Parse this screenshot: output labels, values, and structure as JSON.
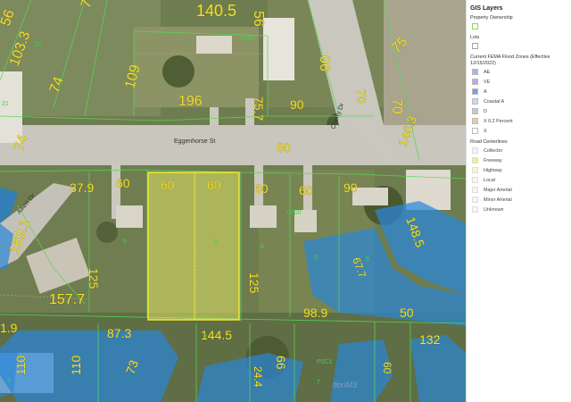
{
  "map": {
    "streets": [
      "Eggenhorse St",
      "Cherry Dr",
      "Aiken Dr"
    ],
    "dimensions": [
      "140.5",
      "56",
      "74",
      "56",
      "103.3",
      "74",
      "74",
      "109",
      "75.7",
      "196",
      "90",
      "90",
      "75",
      "70",
      "146.3",
      "70",
      "37.9",
      "60",
      "60",
      "60",
      "60",
      "60",
      "60",
      "90",
      "125",
      "125",
      "169.1",
      "157.7",
      "148.5",
      "67.7",
      "98.9",
      "50",
      "1.9",
      "87.3",
      "144.5",
      "24.4",
      "66",
      "132",
      "60",
      "73",
      "110",
      "110"
    ],
    "lot_numbers": [
      "20",
      "21",
      "0000",
      "0000",
      "6",
      "6",
      "6",
      "5",
      "5",
      "5",
      "P0C1",
      "7",
      "3"
    ],
    "watermark": "floriM3"
  },
  "legend": {
    "title": "GIS Layers",
    "property_ownership": "Property Ownership",
    "lots": "Lots",
    "flood_title": "Current FEMA Flood Zones (Effective 12/15/2022)",
    "flood_zones": [
      {
        "label": "AE",
        "color": "#a6b3e6"
      },
      {
        "label": "VE",
        "color": "#b9a9e0"
      },
      {
        "label": "A",
        "color": "#7f9ae0"
      },
      {
        "label": "Coastal A",
        "color": "#cfd6ee"
      },
      {
        "label": "D",
        "color": "#c9c9c9"
      },
      {
        "label": "X 0.2 Percent",
        "color": "#e9c9a6"
      },
      {
        "label": "X",
        "color": "#ffffff"
      }
    ],
    "road_title": "Road Centerlines",
    "roads": [
      {
        "label": "Collector",
        "color": "#f3f3f3"
      },
      {
        "label": "Freeway",
        "color": "#f2f08a"
      },
      {
        "label": "Highway",
        "color": "#f7f6c8"
      },
      {
        "label": "Local",
        "color": "#f5f5f5"
      },
      {
        "label": "Major Arterial",
        "color": "#f5f5f5"
      },
      {
        "label": "Minor Arterial",
        "color": "#f5f5f5"
      },
      {
        "label": "Unknown",
        "color": "#f5f5f5"
      }
    ]
  }
}
